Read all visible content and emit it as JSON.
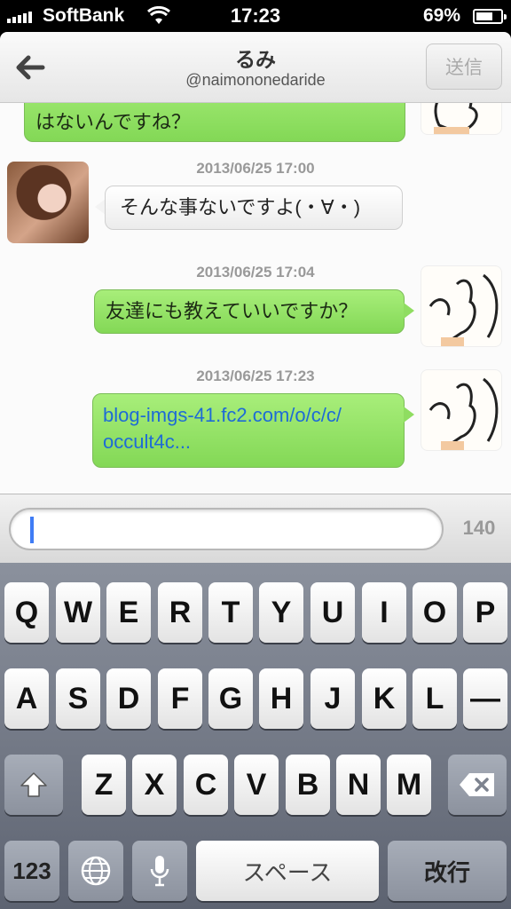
{
  "status_bar": {
    "carrier": "SoftBank",
    "time": "17:23",
    "battery_percent_label": "69%",
    "battery_level": 0.69
  },
  "nav": {
    "back_icon": "back-arrow-icon",
    "title": "るみ",
    "subtitle": "@naimononedaride",
    "send_label": "送信"
  },
  "messages": [
    {
      "side": "right",
      "text": "はないんですね？",
      "partial": true
    },
    {
      "side": "left",
      "timestamp": "2013/06/25 17:00",
      "text": "そんな事ないですよ(・∀・)"
    },
    {
      "side": "right",
      "timestamp": "2013/06/25 17:04",
      "text": "友達にも教えていいですか？"
    },
    {
      "side": "right",
      "timestamp": "2013/06/25 17:23",
      "link_line1": "blog-imgs-41.fc2.com/o/c/c/",
      "link_line2": "occult4c..."
    }
  ],
  "input": {
    "value": "",
    "char_count": "140"
  },
  "keyboard": {
    "row1": [
      "Q",
      "W",
      "E",
      "R",
      "T",
      "Y",
      "U",
      "I",
      "O",
      "P"
    ],
    "row2": [
      "A",
      "S",
      "D",
      "F",
      "G",
      "H",
      "J",
      "K",
      "L",
      "—"
    ],
    "row3": [
      "Z",
      "X",
      "C",
      "V",
      "B",
      "N",
      "M"
    ],
    "numbers_label": "123",
    "space_label": "スペース",
    "return_label": "改行"
  }
}
